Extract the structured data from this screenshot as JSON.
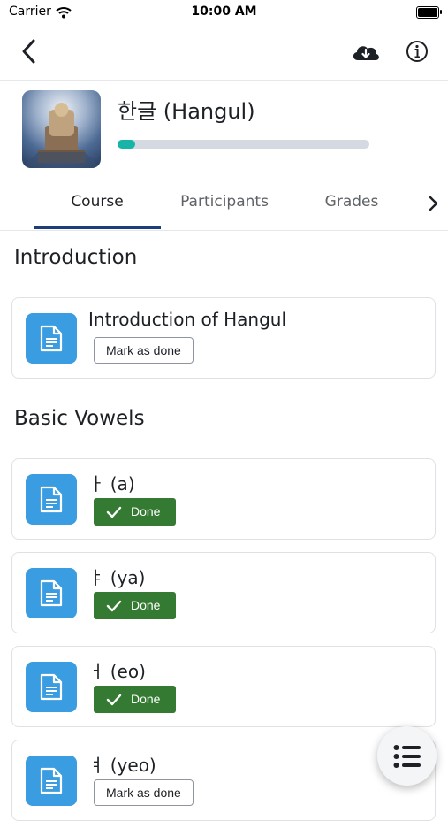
{
  "status_bar": {
    "carrier": "Carrier",
    "time": "10:00 AM"
  },
  "course": {
    "title": "한글 (Hangul)",
    "progress_percent": 7
  },
  "tabs": [
    {
      "label": "Course",
      "active": true
    },
    {
      "label": "Participants",
      "active": false
    },
    {
      "label": "Grades",
      "active": false
    }
  ],
  "sections": [
    {
      "title": "Introduction",
      "activities": [
        {
          "name": "Introduction of Hangul",
          "status": "mark",
          "button_label": "Mark as done"
        }
      ]
    },
    {
      "title": "Basic Vowels",
      "activities": [
        {
          "name": "ㅏ (a)",
          "status": "done",
          "button_label": "Done"
        },
        {
          "name": "ㅑ (ya)",
          "status": "done",
          "button_label": "Done"
        },
        {
          "name": "ㅓ (eo)",
          "status": "done",
          "button_label": "Done"
        },
        {
          "name": "ㅕ (yeo)",
          "status": "mark",
          "button_label": "Mark as done"
        }
      ]
    }
  ],
  "icons": {
    "back": "chevron-left-icon",
    "download": "cloud-download-icon",
    "info": "info-icon",
    "tabs_next": "chevron-right-icon",
    "activity": "document-icon",
    "done_check": "checkmark-icon",
    "fab": "list-icon"
  },
  "colors": {
    "progress_fill": "#16b5a8",
    "progress_track": "#d4d9e2",
    "activity_icon_bg": "#3a9de1",
    "done_bg": "#357a32",
    "tab_underline": "#1d3e7a"
  }
}
